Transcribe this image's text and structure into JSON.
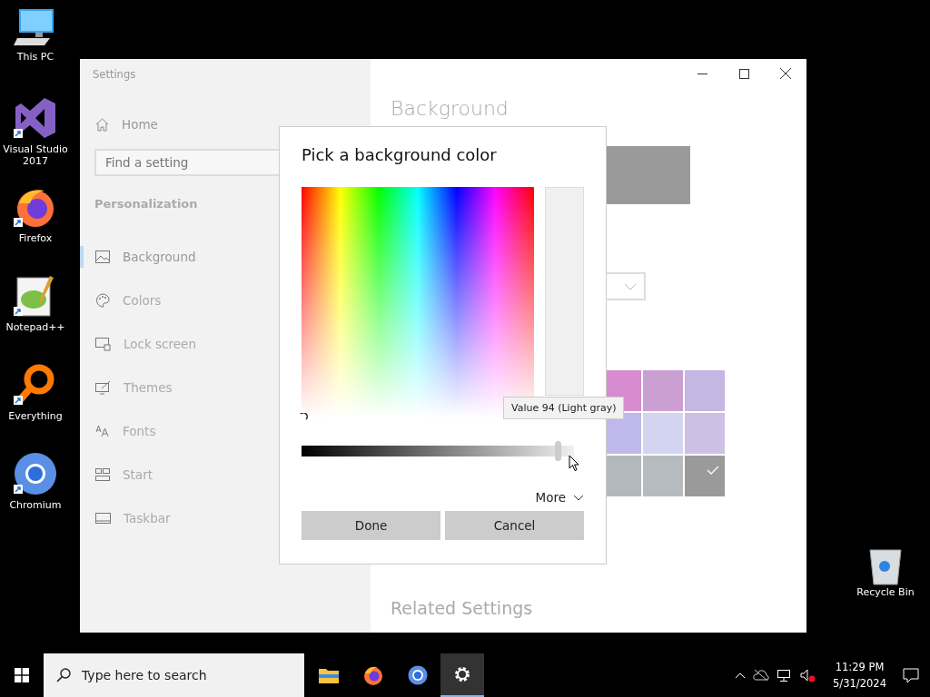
{
  "desktop_icons": [
    {
      "label": "This PC",
      "kind": "pc"
    },
    {
      "label": "Visual Studio 2017",
      "kind": "vs"
    },
    {
      "label": "Firefox",
      "kind": "firefox"
    },
    {
      "label": "Notepad++",
      "kind": "notepad"
    },
    {
      "label": "Everything",
      "kind": "everything"
    },
    {
      "label": "Chromium",
      "kind": "chromium"
    }
  ],
  "recycle_bin": {
    "label": "Recycle Bin"
  },
  "settings_window": {
    "title": "Settings",
    "sidebar": {
      "home": "Home",
      "search_placeholder": "Find a setting",
      "section": "Personalization",
      "items": [
        {
          "label": "Background",
          "kind": "picture",
          "selected": true
        },
        {
          "label": "Colors",
          "kind": "palette",
          "selected": false
        },
        {
          "label": "Lock screen",
          "kind": "lock",
          "selected": false
        },
        {
          "label": "Themes",
          "kind": "themes",
          "selected": false
        },
        {
          "label": "Fonts",
          "kind": "fonts",
          "selected": false
        },
        {
          "label": "Start",
          "kind": "start",
          "selected": false
        },
        {
          "label": "Taskbar",
          "kind": "taskbar",
          "selected": false
        }
      ]
    },
    "content": {
      "heading": "Background",
      "swatches": [
        {
          "color": "#d78ccf",
          "selected": false
        },
        {
          "color": "#cc9fd3",
          "selected": false
        },
        {
          "color": "#c6b6e2",
          "selected": false
        },
        {
          "color": "#bfb8eb",
          "selected": false
        },
        {
          "color": "#d3d5f0",
          "selected": false
        },
        {
          "color": "#cebfe6",
          "selected": false
        },
        {
          "color": "#b3b8bc",
          "selected": false
        },
        {
          "color": "#b6bbbf",
          "selected": false
        },
        {
          "color": "#9a9a9a",
          "selected": true
        }
      ],
      "related_heading": "Related Settings"
    }
  },
  "dialog": {
    "title": "Pick a background color",
    "tooltip": "Value 94 (Light gray)",
    "value_slider": {
      "level": 0.94
    },
    "more": "More",
    "buttons": [
      "Done",
      "Cancel"
    ]
  },
  "taskbar": {
    "search_placeholder": "Type here to search",
    "apps": [
      {
        "kind": "explorer",
        "selected": false
      },
      {
        "kind": "firefox",
        "selected": false
      },
      {
        "kind": "chromium",
        "selected": false
      },
      {
        "kind": "settings",
        "selected": true
      }
    ],
    "time": "11:29 PM",
    "date": "5/31/2024"
  }
}
